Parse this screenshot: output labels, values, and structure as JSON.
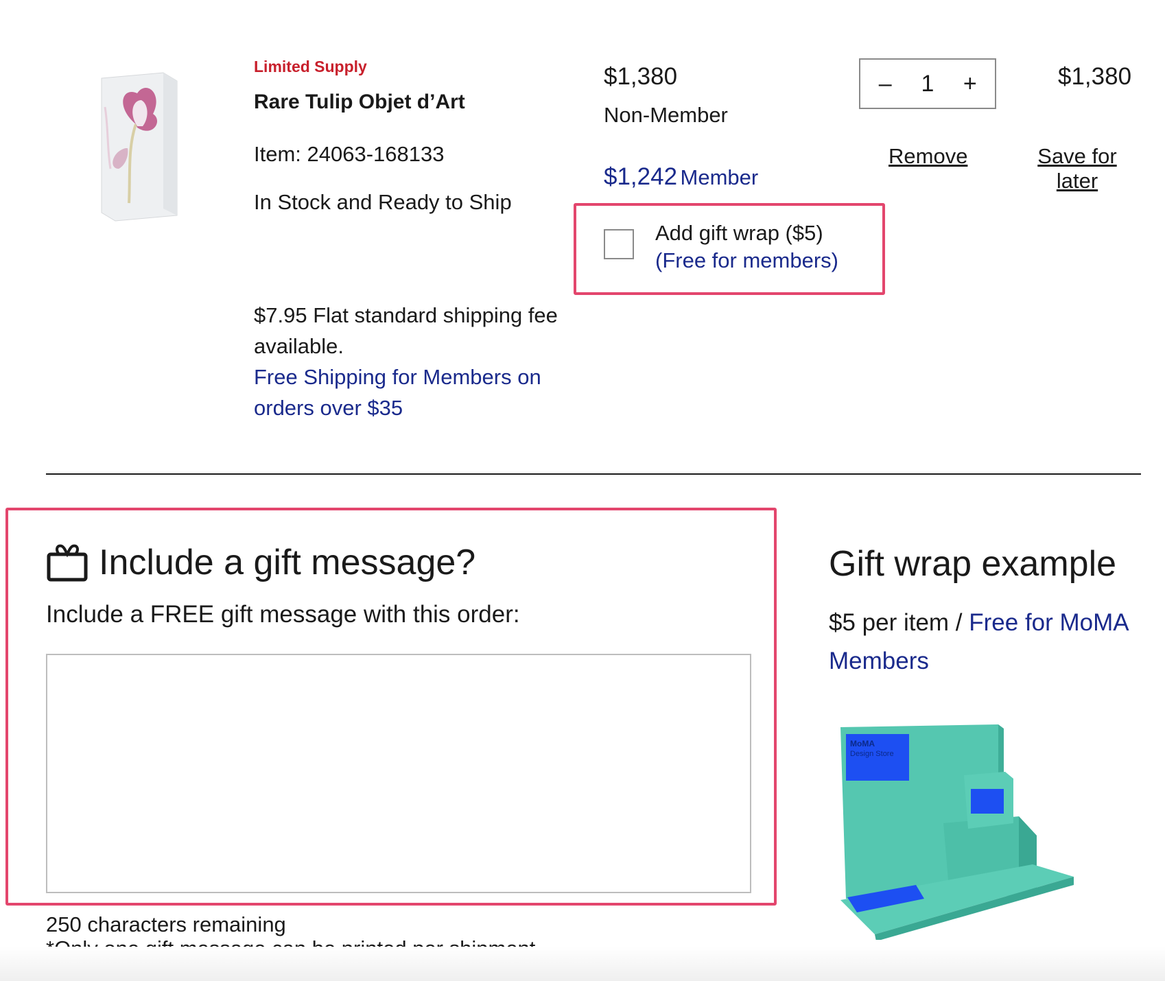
{
  "product": {
    "badge": "Limited Supply",
    "name": "Rare Tulip Objet d’Art",
    "item_number": "Item: 24063-168133",
    "stock_status": "In Stock and Ready to Ship",
    "shipping_note": "$7.95 Flat standard shipping fee available.",
    "member_shipping": "Free Shipping for Members on orders over $35"
  },
  "pricing": {
    "nonmember_price": "$1,380",
    "nonmember_label": "Non-Member",
    "member_price": "$1,242",
    "member_label": "Member"
  },
  "gift_wrap_option": {
    "label": "Add gift wrap ($5)",
    "member_note": "(Free for members)",
    "checked": false
  },
  "quantity": {
    "decrement": "–",
    "value": "1",
    "increment": "+"
  },
  "line_total": "$1,380",
  "actions": {
    "remove": "Remove",
    "save_for_later": "Save for later"
  },
  "gift_message": {
    "title": "Include a gift message?",
    "subtitle": "Include a FREE gift message with this order:",
    "value": "",
    "chars_remaining": "250 characters remaining",
    "note": "*Only one gift message can be printed per shipment."
  },
  "gift_wrap_example": {
    "title": "Gift wrap example",
    "price": "$5 per item / ",
    "member_note": "Free for MoMA Members",
    "box_label_brand": "MoMA",
    "box_label_store": "Design Store"
  },
  "colors": {
    "accent_red": "#c8202c",
    "member_blue": "#1a2a8c",
    "highlight_pink": "#e3466d",
    "wrap_teal": "#55c7b0",
    "label_blue": "#1d4ff2"
  },
  "icons": {
    "gift": "gift-icon",
    "checkbox": "checkbox-unchecked"
  }
}
